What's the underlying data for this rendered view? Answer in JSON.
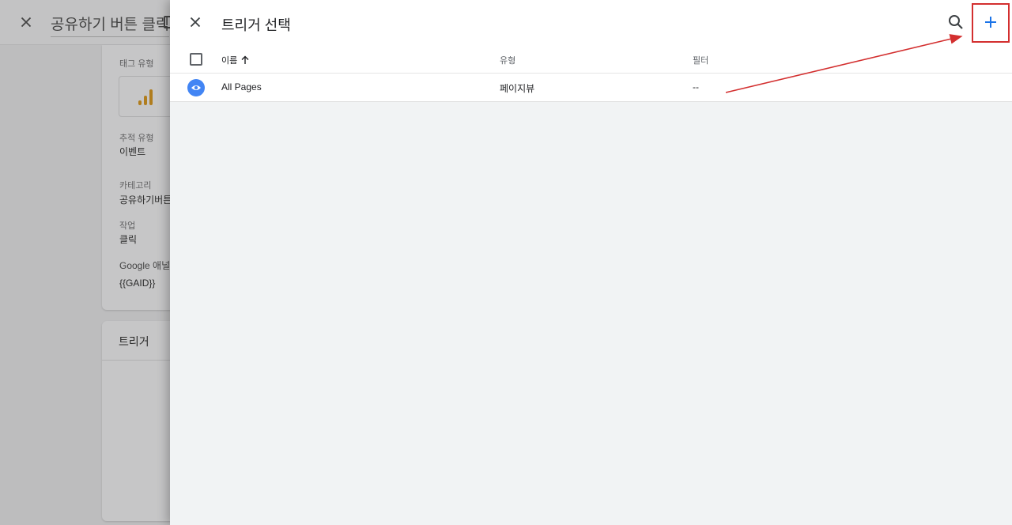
{
  "background": {
    "title": "공유하기 버튼 클릭",
    "fields": {
      "tag_type_label": "태그 유형",
      "track_type_label": "추적 유형",
      "track_type_value": "이벤트",
      "category_label": "카테고리",
      "category_value": "공유하기버튼",
      "action_label": "작업",
      "action_value": "클릭",
      "ga_label": "Google 애널리",
      "ga_value": "{{GAID}}"
    },
    "trigger_card_title": "트리거"
  },
  "panel": {
    "title": "트리거 선택",
    "table": {
      "columns": {
        "name": "이름",
        "type": "유형",
        "filter": "필터"
      },
      "rows": [
        {
          "name": "All Pages",
          "type": "페이지뷰",
          "filter": "--",
          "icon": "eye-icon"
        }
      ]
    }
  },
  "colors": {
    "accent": "#1a73e8",
    "row_icon": "#4285f4",
    "highlight": "#d32f2f",
    "tag_icon": "#b07d1e"
  }
}
